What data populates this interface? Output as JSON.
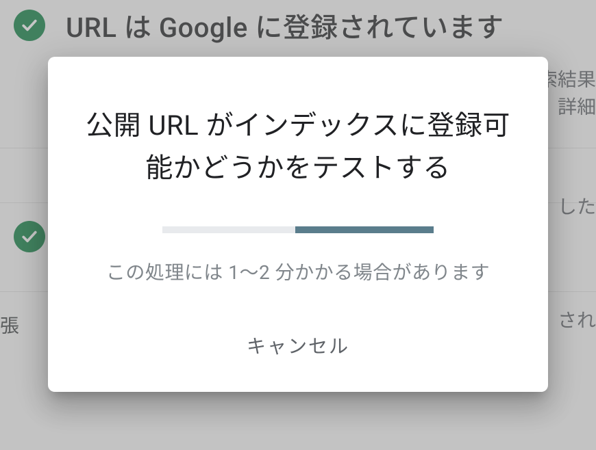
{
  "background": {
    "main_title": "URL は Google に登録されています",
    "right_fragment_1": "索結果",
    "right_fragment_2": "詳細",
    "right_fragment_3": "した",
    "right_fragment_4": "され",
    "bottom_label": "張"
  },
  "dialog": {
    "title": "公開 URL がインデックスに登録可能かどうかをテストする",
    "subtext": "この処理には 1～2 分かかる場合があります",
    "cancel_label": "キャンセル"
  }
}
